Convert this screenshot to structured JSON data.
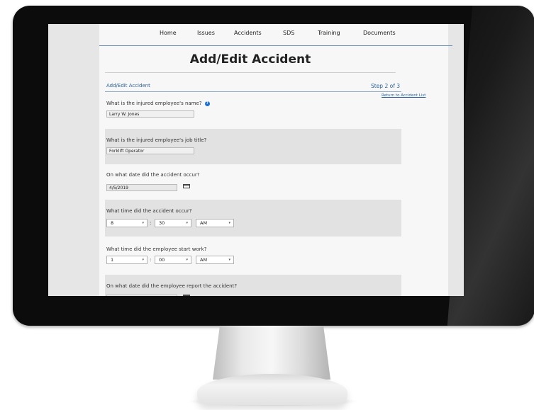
{
  "nav": {
    "items": [
      "Home",
      "Issues",
      "Accidents",
      "SDS",
      "Training",
      "Documents"
    ]
  },
  "page": {
    "title": "Add/Edit Accident",
    "form_label": "Add/Edit Accident",
    "step": "Step 2 of 3",
    "return_link": "Return to Accident List"
  },
  "fields": {
    "employee_name": {
      "question": "What is the injured employee's name?",
      "value": "Larry W. Jones"
    },
    "job_title": {
      "question": "What is the injured employee's job title?",
      "value": "Forklift Operator"
    },
    "accident_date": {
      "question": "On what date did the accident occur?",
      "value": "4/5/2019"
    },
    "accident_time": {
      "question": "What time did the accident occur?",
      "hour": "8",
      "minute": "30",
      "ampm": "AM"
    },
    "start_time": {
      "question": "What time did the employee start work?",
      "hour": "1",
      "minute": "00",
      "ampm": "AM"
    },
    "report_date": {
      "question": "On what date did the employee report the accident?"
    }
  },
  "icons": {
    "help": "question-circle-icon",
    "calendar": "calendar-icon",
    "dropdown": "chevron-down-icon"
  },
  "colors": {
    "link_blue": "#2b5f99",
    "help_blue": "#1c6fcf",
    "shaded_row": "#e2e2e2"
  }
}
